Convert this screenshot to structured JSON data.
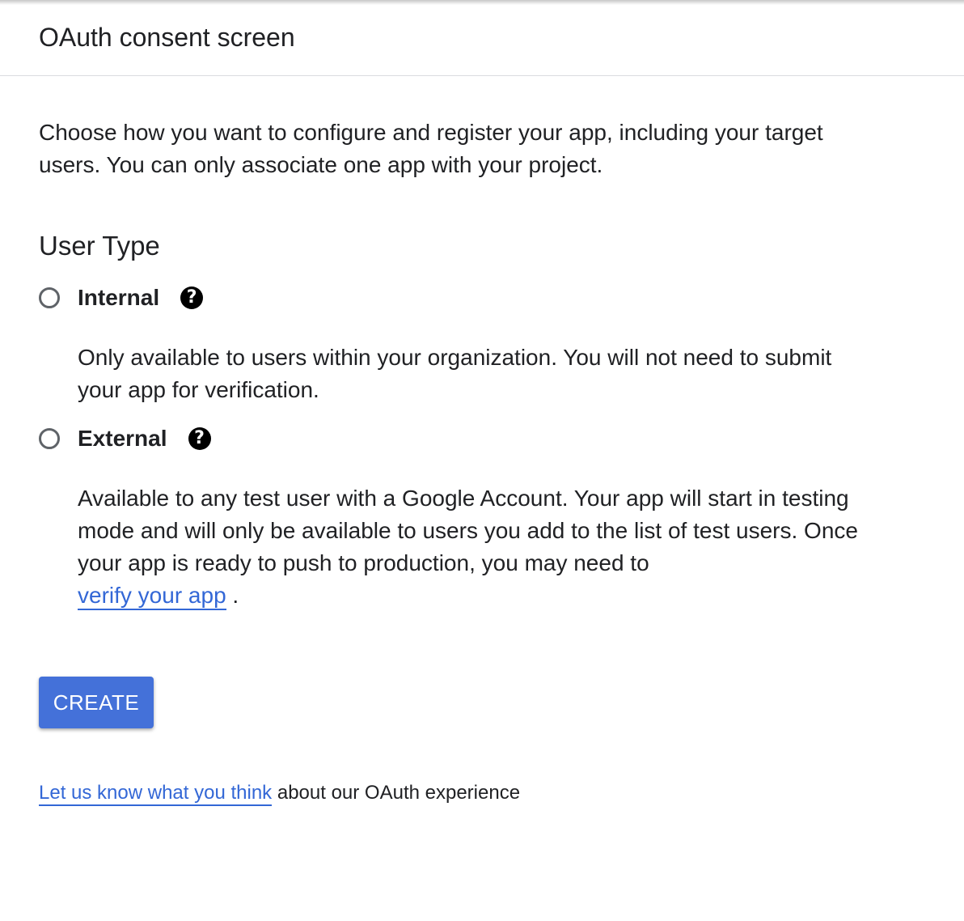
{
  "header": {
    "title": "OAuth consent screen"
  },
  "intro": {
    "text": "Choose how you want to configure and register your app, including your target users. You can only associate one app with your project."
  },
  "user_type": {
    "heading": "User Type",
    "options": [
      {
        "label": "Internal",
        "selected": false,
        "help_icon": "question-circle-icon",
        "description": "Only available to users within your organization. You will not need to submit your app for verification."
      },
      {
        "label": "External",
        "selected": false,
        "help_icon": "question-circle-icon",
        "description_before_link": "Available to any test user with a Google Account. Your app will start in testing mode and will only be available to users you add to the list of test users. Once your app is ready to push to production, you may need to",
        "link_text": "verify your app",
        "description_after_link": "."
      }
    ]
  },
  "actions": {
    "create_label": "CREATE"
  },
  "feedback": {
    "link_text": "Let us know what you think",
    "suffix": "about our OAuth experience"
  },
  "colors": {
    "primary": "#4471d9",
    "link": "#3367d6",
    "text": "#202124",
    "radio_border": "#5f6368",
    "divider": "#dadce0"
  }
}
